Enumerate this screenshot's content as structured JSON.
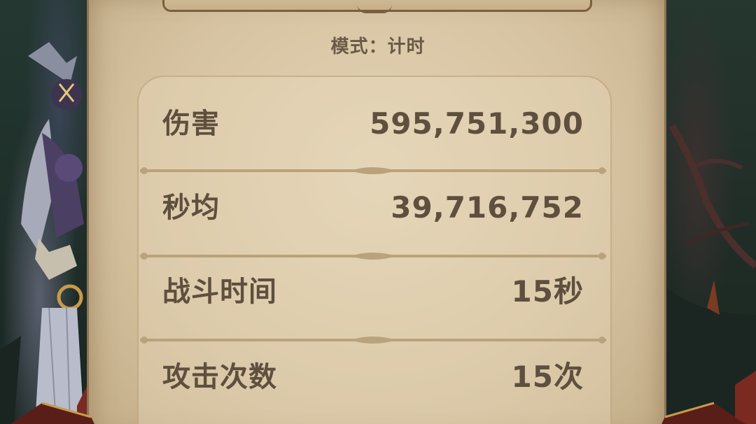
{
  "mode": {
    "label": "模式",
    "separator": "：",
    "value": "计时"
  },
  "stats": [
    {
      "label": "伤害",
      "value": "595,751,300"
    },
    {
      "label": "秒均",
      "value": "39,716,752"
    },
    {
      "label": "战斗时间",
      "value": "15秒"
    },
    {
      "label": "攻击次数",
      "value": "15次"
    }
  ],
  "colors": {
    "parchment": "#d6c3a1",
    "text": "#5e4f3e",
    "frame": "#8b7355"
  }
}
